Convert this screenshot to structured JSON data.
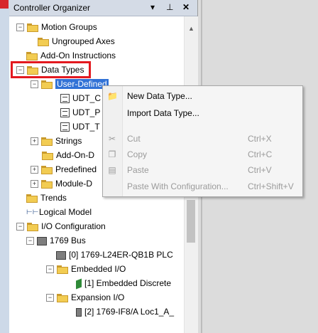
{
  "panel": {
    "title": "Controller Organizer",
    "buttons": [
      "▾",
      "⊥",
      "✕"
    ]
  },
  "tree": [
    {
      "label": "Motion Groups"
    },
    {
      "label": "Ungrouped Axes"
    },
    {
      "label": "Add-On Instructions"
    },
    {
      "label": "Data Types"
    },
    {
      "label": "User-Defined"
    },
    {
      "label": "UDT_C"
    },
    {
      "label": "UDT_P"
    },
    {
      "label": "UDT_T"
    },
    {
      "label": "Strings"
    },
    {
      "label": "Add-On-D"
    },
    {
      "label": "Predefined"
    },
    {
      "label": "Module-D"
    },
    {
      "label": "Trends"
    },
    {
      "label": "Logical Model"
    },
    {
      "label": "I/O Configuration"
    },
    {
      "label": "1769 Bus"
    },
    {
      "label": "[0] 1769-L24ER-QB1B PLC"
    },
    {
      "label": "Embedded I/O"
    },
    {
      "label": "[1] Embedded Discrete"
    },
    {
      "label": "Expansion I/O"
    },
    {
      "label": "[2] 1769-IF8/A Loc1_A_"
    }
  ],
  "context_menu": {
    "items": [
      {
        "label": "New Data Type...",
        "shortcut": "",
        "enabled": true
      },
      {
        "label": "Import Data Type...",
        "shortcut": "",
        "enabled": true
      },
      {
        "label": "Cut",
        "shortcut": "Ctrl+X",
        "enabled": false
      },
      {
        "label": "Copy",
        "shortcut": "Ctrl+C",
        "enabled": false
      },
      {
        "label": "Paste",
        "shortcut": "Ctrl+V",
        "enabled": false
      },
      {
        "label": "Paste With Configuration...",
        "shortcut": "Ctrl+Shift+V",
        "enabled": false
      }
    ]
  },
  "colors": {
    "selection": "#3172d6",
    "highlight_box": "#e3191f",
    "folder": "#f2cc52"
  }
}
